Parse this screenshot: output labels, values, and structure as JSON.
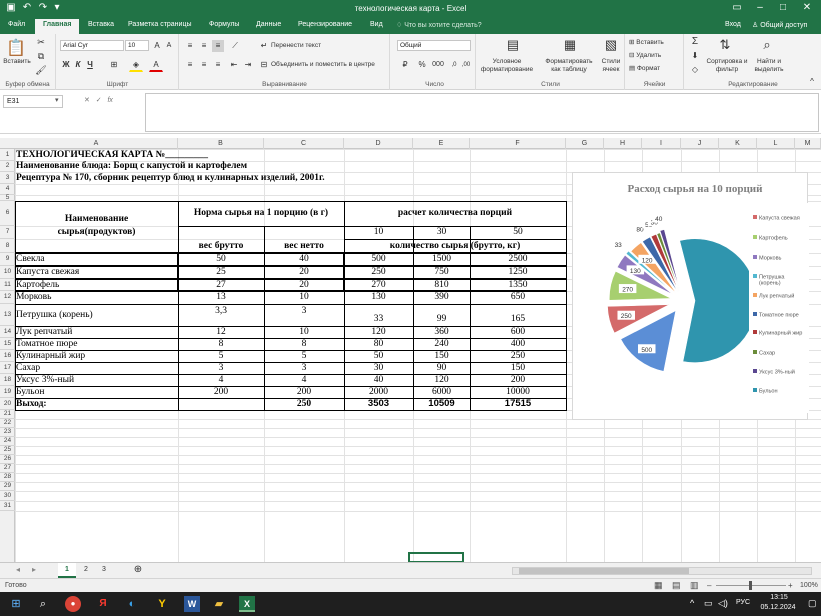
{
  "window": {
    "title": "технологическая карта - Excel"
  },
  "ribbon_tabs": [
    "Файл",
    "Главная",
    "Вставка",
    "Разметка страницы",
    "Формулы",
    "Данные",
    "Рецензирование",
    "Вид"
  ],
  "active_tab": "Главная",
  "tellme": "Что вы хотите сделать?",
  "account": {
    "login": "Вход",
    "share": "Общий доступ"
  },
  "ribbon": {
    "clipboard": {
      "label": "Буфер обмена",
      "paste": "Вставить"
    },
    "font": {
      "label": "Шрифт",
      "name": "Arial Cyr",
      "size": "10",
      "bold": "Ж",
      "italic": "К",
      "underline": "Ч"
    },
    "alignment": {
      "label": "Выравнивание",
      "wrap": "Перенести текст",
      "merge": "Объединить и поместить в центре"
    },
    "number": {
      "label": "Число",
      "format": "Общий"
    },
    "styles": {
      "label": "Стили",
      "conditional": "Условное форматирование",
      "table": "Форматировать как таблицу",
      "cell_styles": "Стили ячеек"
    },
    "cells": {
      "label": "Ячейки",
      "insert": "Вставить",
      "delete": "Удалить",
      "format": "Формат"
    },
    "editing": {
      "label": "Редактирование",
      "sort": "Сортировка и фильтр",
      "find": "Найти и выделить"
    }
  },
  "formula_bar": {
    "name_box": "E31",
    "fx": "fx",
    "value": ""
  },
  "columns": [
    "A",
    "B",
    "C",
    "D",
    "E",
    "F",
    "G",
    "H",
    "I",
    "J",
    "K",
    "L",
    "M"
  ],
  "rows": [
    "1",
    "2",
    "3",
    "4",
    "5",
    "6",
    "7",
    "8",
    "9",
    "10",
    "11",
    "12",
    "13",
    "14",
    "15",
    "16",
    "17",
    "18",
    "19",
    "20",
    "21",
    "22",
    "23",
    "24",
    "25",
    "26",
    "27",
    "28",
    "29",
    "30",
    "31"
  ],
  "sheet": {
    "title": "ТЕХНОЛОГИЧЕСКАЯ КАРТА №_________",
    "dish": "Наименование блюда: Борщ с капустой и картофелем",
    "recipe": "Рецептура № 170, сборник рецептур блюд и кулинарных изделий, 2001г.",
    "header_name": "Наименование сырья(продуктов)",
    "header_norm": "Норма сырья на 1 порцию (в г)",
    "header_calc": "расчет количества порций",
    "header_brutto": "вес брутто",
    "header_netto": "вес нетто",
    "header_portions": [
      "10",
      "30",
      "50"
    ],
    "header_qty": "количество сырья (брутто, кг)",
    "items": [
      {
        "name": "Свекла",
        "brutto": "50",
        "netto": "40",
        "p10": "500",
        "p30": "1500",
        "p50": "2500"
      },
      {
        "name": "Капуста свежая",
        "brutto": "25",
        "netto": "20",
        "p10": "250",
        "p30": "750",
        "p50": "1250"
      },
      {
        "name": "Картофель",
        "brutto": "27",
        "netto": "20",
        "p10": "270",
        "p30": "810",
        "p50": "1350"
      },
      {
        "name": "Морковь",
        "brutto": "13",
        "netto": "10",
        "p10": "130",
        "p30": "390",
        "p50": "650"
      },
      {
        "name": "Петрушка (корень)",
        "brutto": "3,3",
        "netto": "3",
        "p10": "33",
        "p30": "99",
        "p50": "165"
      },
      {
        "name": "Лук репчатый",
        "brutto": "12",
        "netto": "10",
        "p10": "120",
        "p30": "360",
        "p50": "600"
      },
      {
        "name": "Томатное пюре",
        "brutto": "8",
        "netto": "8",
        "p10": "80",
        "p30": "240",
        "p50": "400"
      },
      {
        "name": "Кулинарный жир",
        "brutto": "5",
        "netto": "5",
        "p10": "50",
        "p30": "150",
        "p50": "250"
      },
      {
        "name": "Сахар",
        "brutto": "3",
        "netto": "3",
        "p10": "30",
        "p30": "90",
        "p50": "150"
      },
      {
        "name": "Уксус 3%-ный",
        "brutto": "4",
        "netto": "4",
        "p10": "40",
        "p30": "120",
        "p50": "200"
      },
      {
        "name": "Бульон",
        "brutto": "200",
        "netto": "200",
        "p10": "2000",
        "p30": "6000",
        "p50": "10000"
      }
    ],
    "total": {
      "label": "Выход:",
      "netto": "250",
      "p10": "3503",
      "p30": "10509",
      "p50": "17515"
    }
  },
  "chart_data": {
    "type": "pie",
    "title": "Расход сырья на 10 порций",
    "categories": [
      "Свекла",
      "Капуста свежая",
      "Картофель",
      "Морковь",
      "Петрушка (корень)",
      "Лук репчатый",
      "Томатное пюре",
      "Кулинарный жир",
      "Сахар",
      "Уксус 3%-ный",
      "Бульон"
    ],
    "values": [
      500,
      250,
      270,
      130,
      33,
      120,
      80,
      50,
      30,
      40,
      2000
    ],
    "data_labels": [
      "500",
      "250",
      "270",
      "130",
      "33",
      "120",
      "80",
      "50",
      "30",
      "40"
    ],
    "colors": [
      "#5b8ed6",
      "#d46a6a",
      "#a7cf6f",
      "#8f78c0",
      "#53b8d0",
      "#f4a462",
      "#3d68a8",
      "#b03a3a",
      "#6b8c3a",
      "#5a4790",
      "#2f95ae"
    ],
    "legend": [
      "Капуста свежая",
      "Картофель",
      "Морковь",
      "Петрушка (корень)",
      "Лук репчатый",
      "Томатное пюре",
      "Кулинарный жир",
      "Сахар",
      "Уксус 3%-ный",
      "Бульон"
    ],
    "legend_position": "right",
    "exploded": true
  },
  "sheet_tabs": [
    "1",
    "2",
    "3"
  ],
  "active_sheet": "1",
  "status": {
    "ready": "Готово",
    "zoom": "100%"
  },
  "taskbar": {
    "time": "13:15",
    "date": "05.12.2024",
    "lang": "РУС"
  }
}
